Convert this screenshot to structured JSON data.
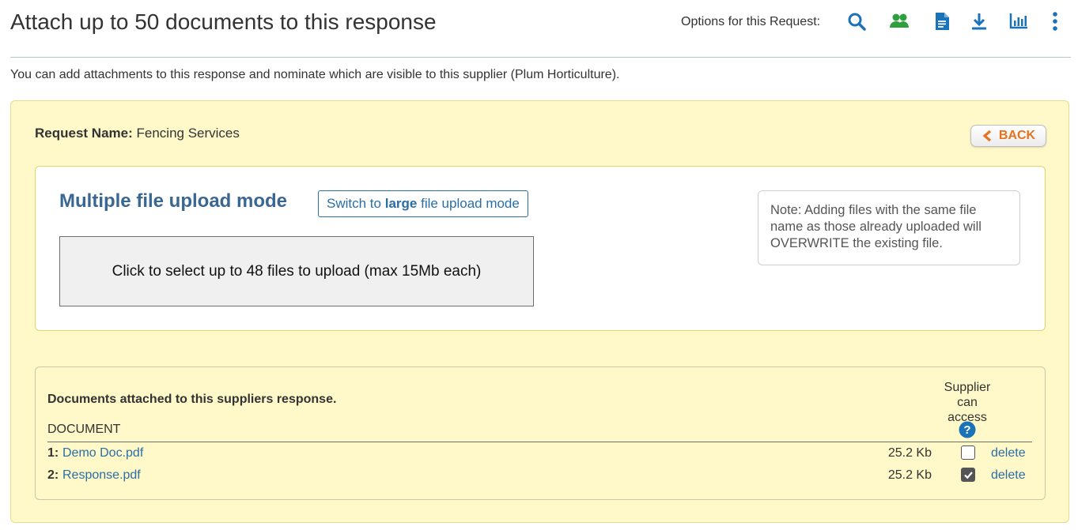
{
  "header": {
    "title": "Attach up to 50 documents to this response",
    "options_label": "Options for this Request:",
    "icons": [
      "search-icon",
      "users-icon",
      "document-icon",
      "download-icon",
      "bar-chart-icon",
      "more-vertical-icon"
    ],
    "icon_colors": {
      "primary": "#1a73b8",
      "users": "#2e9e3e"
    }
  },
  "intro_text": "You can add attachments to this response and nominate which are visible to this supplier (Plum Horticulture).",
  "request": {
    "label": "Request Name:",
    "value": "Fencing Services"
  },
  "back_button": {
    "label": "BACK",
    "color": "#e6741e"
  },
  "upload": {
    "title": "Multiple file upload mode",
    "switch_prefix": "Switch to",
    "switch_bold": "large",
    "switch_suffix": "file upload mode",
    "dropzone_text": "Click to select up to 48 files to upload (max 15Mb each)",
    "note": "Note: Adding files with the same file name as those already uploaded will OVERWRITE the existing file."
  },
  "documents": {
    "heading": "Documents attached to this suppliers response.",
    "col_document": "DOCUMENT",
    "col_access": "Supplier can access",
    "rows": [
      {
        "num": "1:",
        "name": "Demo Doc.pdf",
        "size": "25.2 Kb",
        "access": false,
        "delete_label": "delete"
      },
      {
        "num": "2:",
        "name": "Response.pdf",
        "size": "25.2 Kb",
        "access": true,
        "delete_label": "delete"
      }
    ]
  },
  "colors": {
    "panel_bg": "#fff8c8",
    "link": "#2a6ea6",
    "heading_blue": "#3a6791"
  }
}
